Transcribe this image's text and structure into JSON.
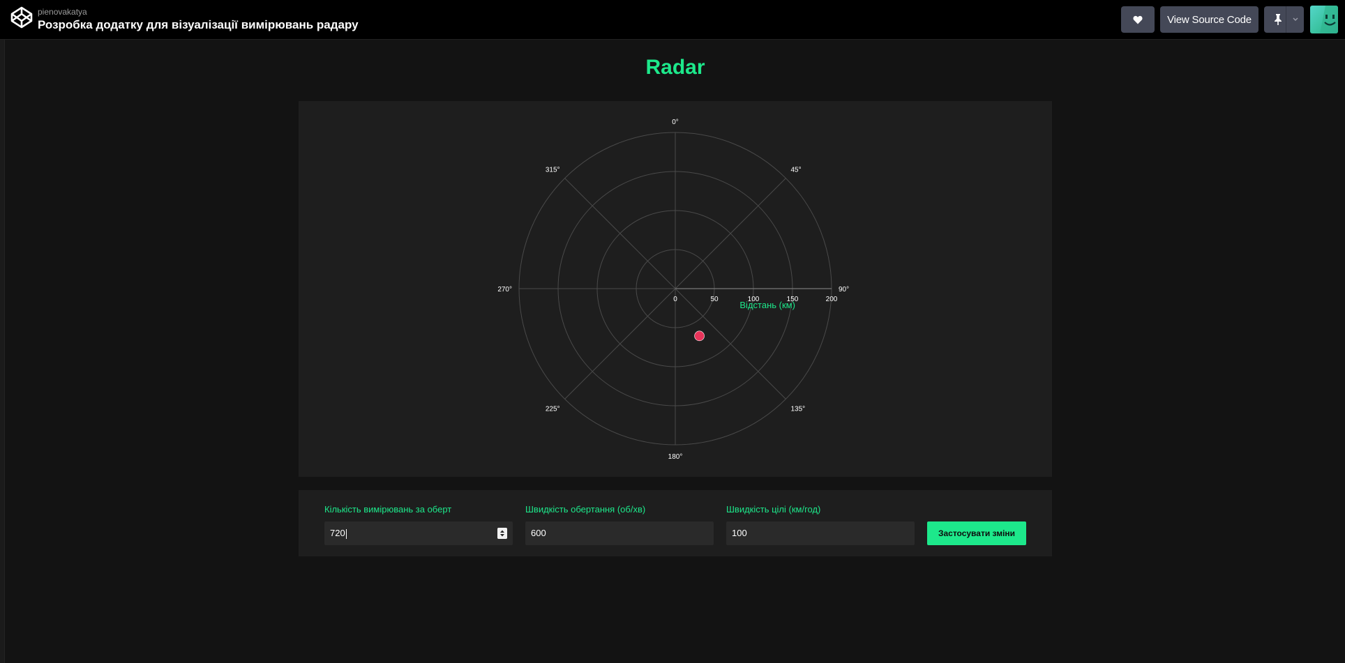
{
  "header": {
    "owner": "pienovakatya",
    "title": "Розробка додатку для візуалізації вимірювань радару",
    "view_source_label": "View Source Code",
    "heart_icon": "heart-icon",
    "pin_icon": "pin-icon",
    "chevron_icon": "chevron-down-icon",
    "logo_icon": "codepen-logo-icon"
  },
  "page": {
    "title": "Radar"
  },
  "chart_data": {
    "type": "scatter",
    "subtype": "polar",
    "radial_axis": {
      "range": [
        0,
        200
      ],
      "ticks": [
        0,
        50,
        100,
        150,
        200
      ],
      "tick_labels": [
        "0",
        "50",
        "100",
        "150",
        "200"
      ],
      "title": "Відстань (км)"
    },
    "angular_axis": {
      "direction": "clockwise",
      "rotation": 0,
      "ticks": [
        0,
        45,
        90,
        135,
        180,
        225,
        270,
        315
      ],
      "tick_labels": [
        "0°",
        "45°",
        "90°",
        "135°",
        "180°",
        "225°",
        "270°",
        "315°"
      ]
    },
    "grid": true,
    "points": [
      {
        "theta": 153,
        "r": 68,
        "color": "#e8345a"
      }
    ],
    "colors": {
      "grid": "#4a4a4a",
      "background": "#1e1e1e",
      "axis_title": "#1de88b",
      "tick": "#ffffff"
    }
  },
  "controls": {
    "measurements": {
      "label": "Кількість вимірювань за оберт",
      "value": "720"
    },
    "rotation_speed": {
      "label": "Швидкість обертання (об/хв)",
      "value": "600"
    },
    "target_speed": {
      "label": "Швидкість цілі (км/год)",
      "value": "100"
    },
    "apply_label": "Застосувати зміни"
  },
  "colors": {
    "accent": "#1de88b",
    "target": "#e8345a",
    "panel": "#1e1e1e",
    "background": "#131313"
  }
}
